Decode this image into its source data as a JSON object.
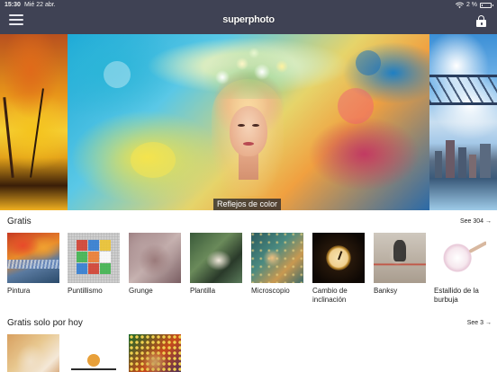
{
  "status_bar": {
    "time": "15:30",
    "date": "Mié 22 abr.",
    "battery": "2 %",
    "battery_level": 0.02
  },
  "nav": {
    "logo": "superphoto",
    "icons": [
      "menu-icon",
      "lock-icon"
    ]
  },
  "hero": {
    "caption": "Reflejos de color"
  },
  "sections": [
    {
      "title": "Gratis",
      "see_all": "See 304 →",
      "items": [
        {
          "label": "Pintura"
        },
        {
          "label": "Puntillismo"
        },
        {
          "label": "Grunge"
        },
        {
          "label": "Plantilla"
        },
        {
          "label": "Microscopio"
        },
        {
          "label": "Cambio de inclinación"
        },
        {
          "label": "Banksy"
        },
        {
          "label": "Estallido de la burbuja"
        }
      ]
    },
    {
      "title": "Gratis solo por hoy",
      "see_all": "See 3 →",
      "items": [
        {
          "label": ""
        },
        {
          "label": ""
        },
        {
          "label": ""
        }
      ]
    }
  ],
  "colors": {
    "nav_background": "#3f4254",
    "page_background": "#ffffff",
    "caption_background": "#28282e"
  }
}
